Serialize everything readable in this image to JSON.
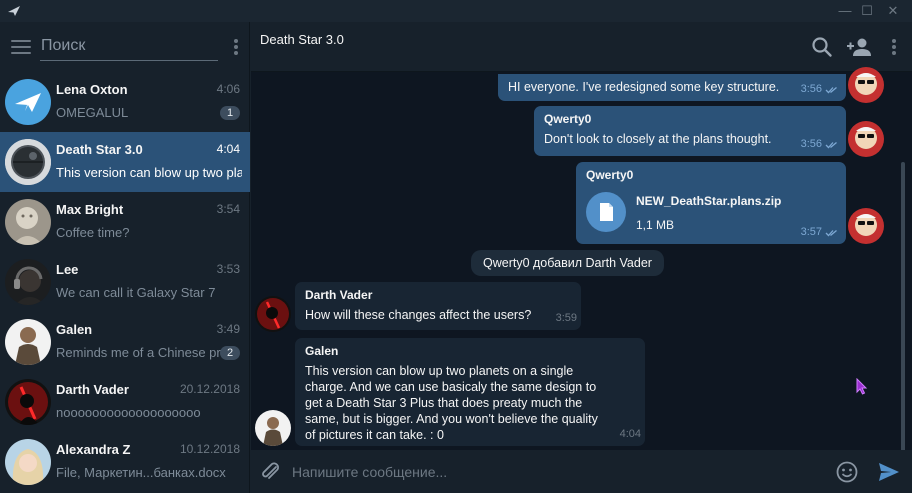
{
  "window": {
    "minimize": "—",
    "maximize": "☐",
    "close": "✕"
  },
  "search": {
    "placeholder": "Поиск"
  },
  "chats": [
    {
      "name": "Lena Oxton",
      "time": "4:06",
      "preview": "OMEGALUL",
      "badge": "1",
      "avatar": "telegram-logo"
    },
    {
      "name": "Death Star 3.0",
      "time": "4:04",
      "preview": "This version can blow up two pla",
      "badge": "",
      "avatar": "death-star"
    },
    {
      "name": "Max Bright",
      "time": "3:54",
      "preview": "Coffee time?",
      "badge": "",
      "avatar": "statue"
    },
    {
      "name": "Lee",
      "time": "3:53",
      "preview": "We can call it Galaxy Star 7",
      "badge": "",
      "avatar": "headphones"
    },
    {
      "name": "Galen",
      "time": "3:49",
      "preview": "Reminds me of a Chinese pro",
      "badge": "2",
      "avatar": "man"
    },
    {
      "name": "Darth Vader",
      "time": "20.12.2018",
      "preview": "nooooooooooooooooooo",
      "badge": "",
      "avatar": "vader"
    },
    {
      "name": "Alexandra Z",
      "time": "10.12.2018",
      "preview": "File, Маркетин...банках.docx",
      "badge": "",
      "avatar": "woman"
    }
  ],
  "conversation": {
    "title": "Death Star 3.0",
    "messages": [
      {
        "type": "out",
        "sender": "",
        "text": "HI everyone. I've redesigned some key structure.",
        "time": "3:56"
      },
      {
        "type": "out",
        "sender": "Qwerty0",
        "text": "Don't look to closely at the plans thought.",
        "time": "3:56"
      },
      {
        "type": "file",
        "sender": "Qwerty0",
        "file_name": "NEW_DeathStar.plans.zip",
        "file_size": "1,1 MB",
        "time": "3:57"
      },
      {
        "type": "service",
        "text": "Qwerty0 добавил Darth Vader"
      },
      {
        "type": "in",
        "sender": "Darth Vader",
        "text": "How will these changes affect the users?",
        "time": "3:59"
      },
      {
        "type": "in",
        "sender": "Galen",
        "lines": [
          "This version can blow up two planets on a single",
          "charge. And we can use basicaly the same design to",
          "get a Death Star 3 Plus that does preaty much the",
          "same, but is bigger. And you won't believe the quality",
          "of pictures it can take. : 0"
        ],
        "time": "4:04"
      }
    ]
  },
  "composer": {
    "placeholder": "Напишите сообщение..."
  },
  "colors": {
    "accent": "#5290c9",
    "active_chat": "#2b5278",
    "bg": "#0e1621",
    "sidebar": "#17212b"
  },
  "icons": [
    "menu-icon",
    "more-vert-icon",
    "search-icon",
    "add-user-icon",
    "attach-icon",
    "emoji-icon",
    "send-icon",
    "file-icon",
    "double-check-icon"
  ]
}
